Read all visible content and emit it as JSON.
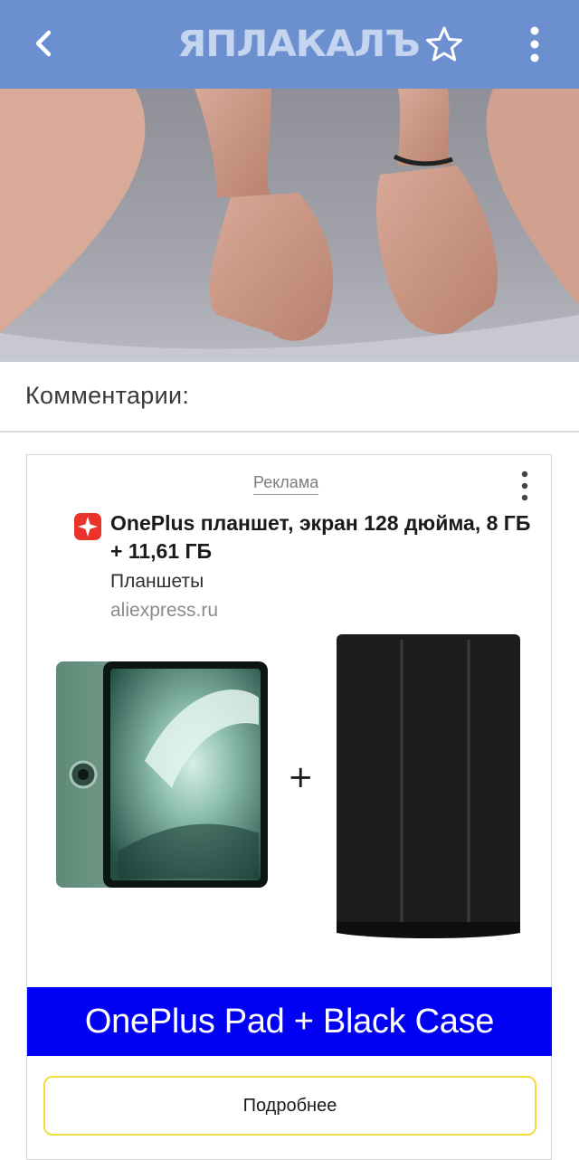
{
  "header": {
    "logo_text": "ЯПЛАКАЛЪ",
    "back_icon": "chevron-left-icon",
    "favorite_icon": "star-icon",
    "menu_icon": "more-vertical-icon",
    "bar_color": "#6b8fcf"
  },
  "comments": {
    "title": "Комментарии:"
  },
  "ad": {
    "label": "Реклама",
    "brand_icon": "aliexpress-icon",
    "title": "OnePlus планшет, экран 128 дюйма, 8 ГБ + 11,61 ГБ",
    "category": "Планшеты",
    "domain": "aliexpress.ru",
    "plus_sign": "+",
    "banner_text": "OnePlus Pad + Black Case",
    "banner_color": "#0000f5",
    "button_label": "Подробнее",
    "button_border_color": "#f2dc3c"
  }
}
